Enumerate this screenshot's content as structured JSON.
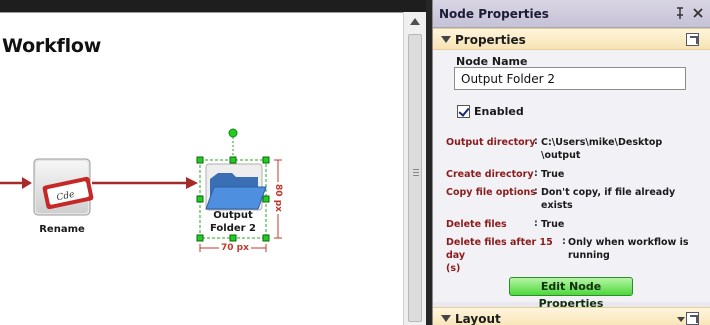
{
  "canvas": {
    "title": "Workflow",
    "nodes": [
      {
        "label": "Rename"
      },
      {
        "label_line1": "Output",
        "label_line2": "Folder 2"
      }
    ],
    "dimensions": {
      "width_label": "70 px",
      "height_label": "80 px"
    }
  },
  "panel": {
    "title": "Node Properties",
    "pin_icon": "pin-icon",
    "close_icon": "close-icon",
    "properties_section": {
      "title": "Properties",
      "node_name_label": "Node Name",
      "node_name_value": "Output Folder 2",
      "enabled_label": "Enabled",
      "enabled_checked": true,
      "rows": [
        {
          "key": "Output directory",
          "value_line1": "C:\\Users\\mike\\Desktop",
          "value_line2": "\\output"
        },
        {
          "key": "Create directory",
          "value_line1": "True"
        },
        {
          "key": "Copy file options",
          "value_line1": "Don't copy, if file already",
          "value_line2": "exists"
        },
        {
          "key": "Delete files",
          "value_line1": "True"
        },
        {
          "key_line1": "Delete files after 15 day",
          "key_line2": "(s)",
          "value_line1": "Only when workflow is",
          "value_line2": "running"
        }
      ],
      "edit_button_label": "Edit Node Properties"
    },
    "layout_section": {
      "title": "Layout"
    }
  },
  "colors": {
    "accent_green": "#4cd83a",
    "connector_red": "#a52a2a",
    "selection_green": "#22cc22",
    "dimension_red": "#c0392b"
  }
}
